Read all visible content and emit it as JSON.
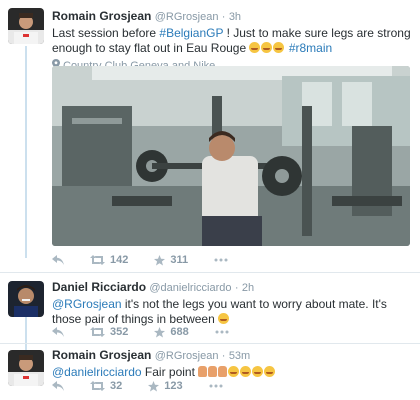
{
  "tweets": [
    {
      "name": "Romain Grosjean",
      "handle": "@RGrosjean",
      "separator": "·",
      "time": "3h",
      "text_a": "Last session before ",
      "link_a": "#BelgianGP",
      "text_b": " ! Just to make sure legs are strong enough to stay flat out in Eau Rouge ",
      "link_b": "#r8main",
      "emoji_count": 3,
      "location": "Country Club Geneva and Nike",
      "retweets": "142",
      "favorites": "311"
    },
    {
      "name": "Daniel Ricciardo",
      "handle": "@danielricciardo",
      "separator": "·",
      "time": "2h",
      "link_a": "@RGrosjean",
      "text_a": " it's not the legs you want to worry about mate. It's those pair of things in between ",
      "retweets": "352",
      "favorites": "688"
    },
    {
      "name": "Romain Grosjean",
      "handle": "@RGrosjean",
      "separator": "·",
      "time": "53m",
      "link_a": "@danielricciardo",
      "text_a": " Fair point ",
      "retweets": "32",
      "favorites": "123"
    }
  ],
  "colors": {
    "link": "#2b7bb9",
    "muted": "#8899a6",
    "thread": "#cce0ee"
  },
  "icons": [
    "reply-icon",
    "retweet-icon",
    "favorite-icon",
    "more-icon",
    "location-pin-icon"
  ]
}
